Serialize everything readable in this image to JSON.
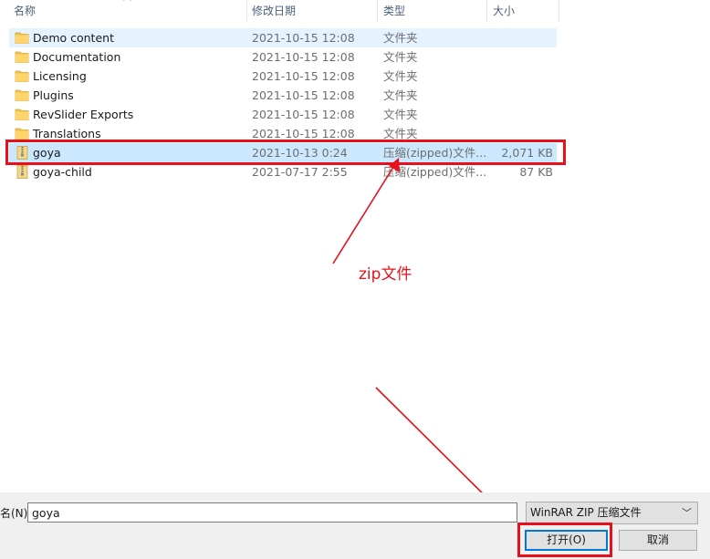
{
  "header": {
    "col_name": "名称",
    "col_date": "修改日期",
    "col_type": "类型",
    "col_size": "大小"
  },
  "files": [
    {
      "name": "Demo content",
      "date": "2021-10-15  12:08",
      "type": "文件夹",
      "size": "",
      "icon": "folder-icon"
    },
    {
      "name": "Documentation",
      "date": "2021-10-15  12:08",
      "type": "文件夹",
      "size": "",
      "icon": "folder-icon"
    },
    {
      "name": "Licensing",
      "date": "2021-10-15  12:08",
      "type": "文件夹",
      "size": "",
      "icon": "folder-icon"
    },
    {
      "name": "Plugins",
      "date": "2021-10-15  12:08",
      "type": "文件夹",
      "size": "",
      "icon": "folder-icon"
    },
    {
      "name": "RevSlider Exports",
      "date": "2021-10-15  12:08",
      "type": "文件夹",
      "size": "",
      "icon": "folder-icon"
    },
    {
      "name": "Translations",
      "date": "2021-10-15  12:08",
      "type": "文件夹",
      "size": "",
      "icon": "folder-icon"
    },
    {
      "name": "goya",
      "date": "2021-10-13  0:24",
      "type": "压缩(zipped)文件...",
      "size": "2,071 KB",
      "icon": "zip-file-icon"
    },
    {
      "name": "goya-child",
      "date": "2021-07-17  2:55",
      "type": "压缩(zipped)文件...",
      "size": "87 KB",
      "icon": "zip-file-icon"
    }
  ],
  "annotation": {
    "label": "zip文件",
    "color": "#e8101a"
  },
  "bottom": {
    "filename_label": "名(N):",
    "filename_value": "goya",
    "filetype_value": "WinRAR ZIP 压缩文件",
    "open_label": "打开(O)",
    "cancel_label": "取消"
  },
  "colors": {
    "selected_row": "#cce8ff",
    "hover_row": "#e5f3ff",
    "folder": "#f2c14e",
    "accent": "#0078d7"
  }
}
